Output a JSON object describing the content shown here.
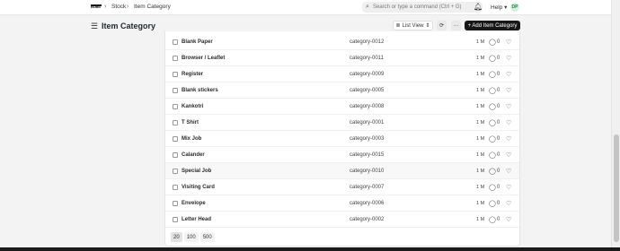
{
  "navbar": {
    "logo": "BOBS",
    "breadcrumbs": [
      "Stock",
      "Item Category"
    ],
    "search_placeholder": "Search or type a command (Ctrl + G)",
    "help_label": "Help",
    "avatar_initials": "DP"
  },
  "page": {
    "title": "Item Category",
    "list_view_label": "List View",
    "add_button_label": "+ Add Item Category"
  },
  "rows": [
    {
      "name": "Blank Paper",
      "code": "category-0012",
      "modified": "1 M",
      "comments": "0"
    },
    {
      "name": "Browser / Leaflet",
      "code": "category-0011",
      "modified": "1 M",
      "comments": "0"
    },
    {
      "name": "Register",
      "code": "category-0009",
      "modified": "1 M",
      "comments": "0"
    },
    {
      "name": "Blank stickers",
      "code": "category-0005",
      "modified": "1 M",
      "comments": "0"
    },
    {
      "name": "Kankotri",
      "code": "category-0008",
      "modified": "1 M",
      "comments": "0"
    },
    {
      "name": "T Shirt",
      "code": "category-0001",
      "modified": "1 M",
      "comments": "0"
    },
    {
      "name": "Mix Job",
      "code": "category-0003",
      "modified": "1 M",
      "comments": "0"
    },
    {
      "name": "Calander",
      "code": "category-0015",
      "modified": "1 M",
      "comments": "0"
    },
    {
      "name": "Special Job",
      "code": "category-0010",
      "modified": "1 M",
      "comments": "0"
    },
    {
      "name": "Visiting Card",
      "code": "category-0007",
      "modified": "1 M",
      "comments": "0"
    },
    {
      "name": "Envelope",
      "code": "category-0006",
      "modified": "1 M",
      "comments": "0"
    },
    {
      "name": "Letter Head",
      "code": "category-0002",
      "modified": "1 M",
      "comments": "0"
    }
  ],
  "paging": [
    "20",
    "100",
    "500"
  ],
  "icons": {
    "comment": "comment-icon",
    "like": "heart-icon",
    "search": "search-icon",
    "notification": "bell-icon",
    "refresh": "refresh-icon",
    "more": "more-icon",
    "menu": "hamburger-icon"
  },
  "colors": {
    "primary_button": "#171717",
    "avatar_bg": "#d3f2dd",
    "avatar_text": "#2d7a4a"
  }
}
